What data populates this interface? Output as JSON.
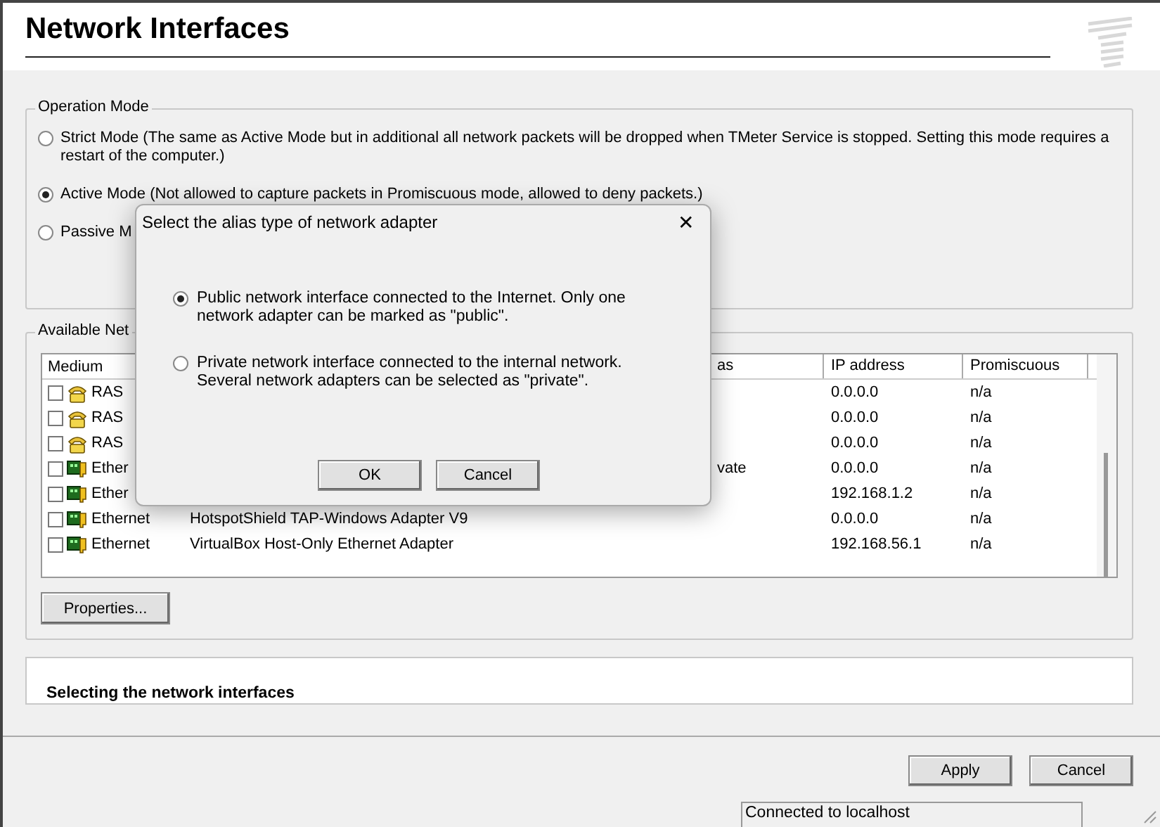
{
  "header": {
    "title": "Network Interfaces"
  },
  "operation_mode": {
    "label": "Operation Mode",
    "options": [
      {
        "label": "Strict Mode (The same as Active Mode but in additional all network packets will be dropped when TMeter Service is stopped. Setting this mode requires a restart of the computer.)",
        "selected": false
      },
      {
        "label": "Active Mode (Not allowed to capture packets in Promiscuous mode, allowed to deny packets.)",
        "selected": true
      },
      {
        "label": "Passive M",
        "selected": false
      }
    ]
  },
  "networks": {
    "label": "Available Net",
    "columns": [
      "Medium",
      "as",
      "IP address",
      "Promiscuous"
    ],
    "rows": [
      {
        "kind": "ras",
        "medium": "RAS",
        "checked": false,
        "ip": "0.0.0.0",
        "promiscuous": "n/a"
      },
      {
        "kind": "ras",
        "medium": "RAS",
        "checked": false,
        "ip": "0.0.0.0",
        "promiscuous": "n/a"
      },
      {
        "kind": "ras",
        "medium": "RAS",
        "checked": false,
        "ip": "0.0.0.0",
        "promiscuous": "n/a"
      },
      {
        "kind": "ethernet",
        "medium": "Ether",
        "checked": false,
        "column_3": "vate",
        "ip": "0.0.0.0",
        "promiscuous": "n/a"
      },
      {
        "kind": "ethernet",
        "medium": "Ether",
        "checked": false,
        "ip": "192.168.1.2",
        "promiscuous": "n/a"
      },
      {
        "kind": "ethernet",
        "medium": "Ethernet",
        "checked": false,
        "description": "HotspotShield TAP-Windows Adapter V9",
        "ip": "0.0.0.0",
        "promiscuous": "n/a"
      },
      {
        "kind": "ethernet",
        "medium": "Ethernet",
        "checked": false,
        "description": "VirtualBox Host-Only Ethernet Adapter",
        "ip": "192.168.56.1",
        "promiscuous": "n/a"
      }
    ],
    "properties_button": "Properties..."
  },
  "help": {
    "heading": "Selecting the network interfaces"
  },
  "buttons": [
    "Apply",
    "Cancel"
  ],
  "status_bar": {
    "text": "Connected to localhost"
  },
  "dialog": {
    "title": "Select the alias type of network adapter",
    "close": "✕",
    "options": [
      {
        "label": "Public network interface connected to the Internet. Only one network adapter can be marked as \"public\".",
        "selected": true
      },
      {
        "label": "Private network interface connected to the internal network. Several network adapters can be selected as \"private\".",
        "selected": false
      }
    ],
    "buttons": [
      "OK",
      "Cancel"
    ]
  }
}
